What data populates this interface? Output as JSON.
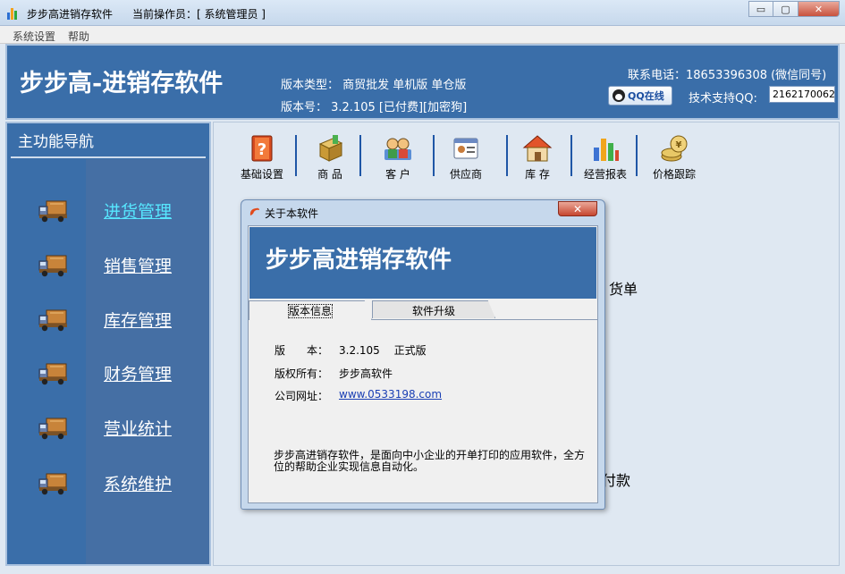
{
  "window": {
    "title": "步步高进销存软件",
    "operator": "当前操作员：[ 系统管理员 ]",
    "controls": {
      "minimize": "▭",
      "maximize": "▢",
      "close": "✕"
    }
  },
  "menu": [
    "系统设置",
    "帮助"
  ],
  "header": {
    "brand": "步步高-进销存软件",
    "version_type": "版本类型：  商贸批发  单机版  单仓版",
    "version_no": "版本号：  3.2.105  [已付费][加密狗]",
    "phone": "联系电话：18653396308 (微信同号)",
    "qq_button": "QQ在线",
    "qq_label": "技术支持QQ:",
    "qq_value": "2162170062"
  },
  "sidebar": {
    "title": "主功能导航",
    "items": [
      {
        "label": "进货管理",
        "active": true
      },
      {
        "label": "销售管理",
        "active": false
      },
      {
        "label": "库存管理",
        "active": false
      },
      {
        "label": "财务管理",
        "active": false
      },
      {
        "label": "营业统计",
        "active": false
      },
      {
        "label": "系统维护",
        "active": false
      }
    ]
  },
  "toolbar": [
    {
      "label": "基础设置",
      "icon": "book-help-icon"
    },
    {
      "label": "商 品",
      "icon": "box-icon"
    },
    {
      "label": "客 户",
      "icon": "customer-icon"
    },
    {
      "label": "供应商",
      "icon": "supplier-card-icon"
    },
    {
      "label": "库 存",
      "icon": "house-icon"
    },
    {
      "label": "经营报表",
      "icon": "bar-chart-icon"
    },
    {
      "label": "价格跟踪",
      "icon": "coins-icon"
    }
  ],
  "background_labels": {
    "top": "货单",
    "bottom": "付款"
  },
  "dialog": {
    "title": "关于本软件",
    "close": "✕",
    "banner": "步步高进销存软件",
    "tabs": [
      "版本信息",
      "软件升级"
    ],
    "version_label": "版　　本：",
    "version_value": "3.2.105　 正式版",
    "copyright_label": "版权所有：",
    "copyright_value": "步步高软件",
    "website_label": "公司网址：",
    "website_value": "www.0533198.com",
    "description": "步步高进销存软件，是面向中小企业的开单打印的应用软件，全方位的帮助企业实现信息自动化。"
  },
  "colors": {
    "banner": "#3a6ea9",
    "active_nav": "#57e7ff",
    "separator": "#1f56a6"
  }
}
